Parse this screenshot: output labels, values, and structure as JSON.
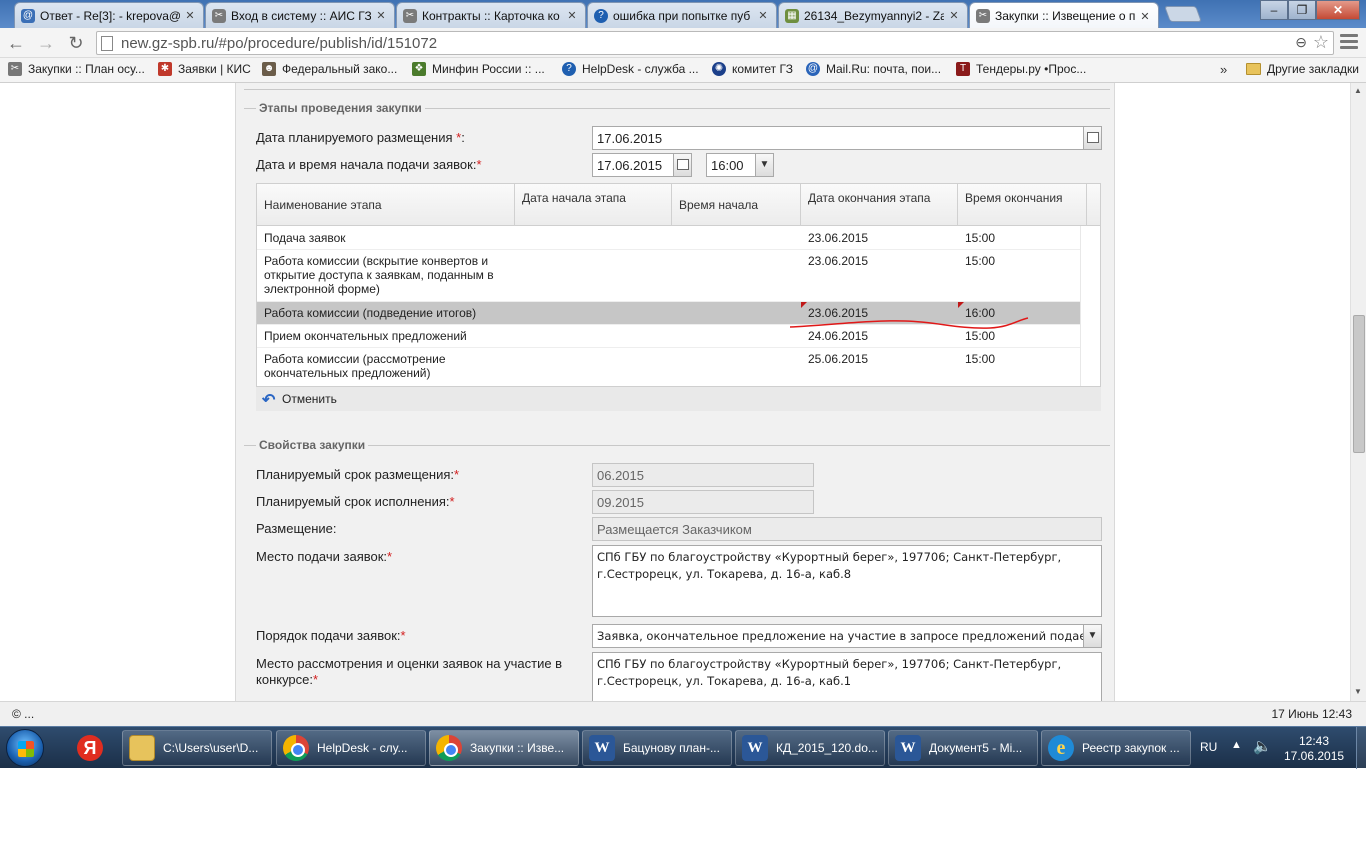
{
  "tabs": [
    {
      "title": "Ответ - Re[3]: - krepova@",
      "favicon_color": "#3b6fb6"
    },
    {
      "title": "Вход в систему :: АИС ГЗ",
      "favicon_color": "#7a7a7a"
    },
    {
      "title": "Контракты :: Карточка ко",
      "favicon_color": "#7a7a7a"
    },
    {
      "title": "ошибка при попытке пуб",
      "favicon_color": "#1f5fb0"
    },
    {
      "title": "26134_Bezymyannyi2 - Za",
      "favicon_color": "#6f8f3f"
    },
    {
      "title": "Закупки :: Извещение о п",
      "favicon_color": "#7a7a7a",
      "active": true
    }
  ],
  "browser": {
    "url": "new.gz-spb.ru/#po/procedure/publish/id/151072",
    "bookmarks": [
      {
        "label": "Закупки :: План осу...",
        "icon": "tools-icon",
        "color": "#777777"
      },
      {
        "label": "Заявки | КИС",
        "icon": "kis-icon",
        "color": "#c0392b"
      },
      {
        "label": "Федеральный зако...",
        "icon": "person-icon",
        "color": "#6b5d4a"
      },
      {
        "label": "Минфин России :: ...",
        "icon": "emblem-icon",
        "color": "#4b7b2c"
      },
      {
        "label": "HelpDesk - служба ...",
        "icon": "help-icon",
        "color": "#1f5fb0"
      },
      {
        "label": "комитет ГЗ",
        "icon": "globe-icon",
        "color": "#1b3f8a"
      },
      {
        "label": "Mail.Ru: почта, пои...",
        "icon": "mail-icon",
        "color": "#2a64b9"
      },
      {
        "label": "Тендеры.ру •Прос...",
        "icon": "t-icon",
        "color": "#8a1a1a"
      }
    ],
    "more": "»",
    "other_bookmarks": "Другие закладки"
  },
  "stages": {
    "legend": "Этапы проведения закупки",
    "planned_date_label": "Дата планируемого размещения ",
    "planned_date_value": "17.06.2015",
    "start_label": "Дата и время начала подачи заявок:",
    "start_date": "17.06.2015",
    "start_time": "16:00",
    "required_mark": "*",
    "colon": ":",
    "columns": [
      "Наименование этапа",
      "Дата начала этапа",
      "Время начала",
      "Дата окончания этапа",
      "Время окончания"
    ],
    "rows": [
      {
        "name": "Подача заявок",
        "end_date": "23.06.2015",
        "end_time": "15:00"
      },
      {
        "name": "Работа комиссии (вскрытие конвертов и открытие доступа к заявкам, поданным в электронной форме)",
        "end_date": "23.06.2015",
        "end_time": "15:00"
      },
      {
        "name": "Работа комиссии (подведение итогов)",
        "end_date": "23.06.2015",
        "end_time": "16:00",
        "selected": true
      },
      {
        "name": "Прием окончательных предложений",
        "end_date": "24.06.2015",
        "end_time": "15:00"
      },
      {
        "name": "Работа комиссии (рассмотрение окончательных предложений)",
        "end_date": "25.06.2015",
        "end_time": "15:00"
      }
    ],
    "undo_label": "Отменить"
  },
  "props": {
    "legend": "Свойства закупки",
    "plan_placement_label": "Планируемый срок размещения:",
    "plan_placement_value": "06.2015",
    "plan_execution_label": "Планируемый срок исполнения:",
    "plan_execution_value": "09.2015",
    "placement_label": "Размещение:",
    "placement_value": "Размещается Заказчиком",
    "submit_place_label": "Место подачи заявок:",
    "submit_place_value": "СПб ГБУ по благоустройству «Курортный берег», 197706; Санкт-Петербург, г.Сестрорецк, ул. Токарева, д. 16-а, каб.8",
    "order_label": "Порядок подачи заявок:",
    "order_value": "Заявка, окончательное предложение на участие в запросе предложений подает",
    "review_place_label_1": "Место рассмотрения и оценки заявок на участие в",
    "review_place_label_2": "конкурсе:",
    "review_place_value": "СПб ГБУ по благоустройству «Курортный берег», 197706; Санкт-Петербург, г.Сестрорецк, ул. Токарева, д. 16-а, каб.1"
  },
  "status": {
    "left": "© ...",
    "right": "17 Июнь 12:43"
  },
  "taskbar": {
    "items": [
      {
        "label": "",
        "icon": "yandex-icon"
      },
      {
        "label": "C:\\Users\\user\\D...",
        "icon": "folder-icon"
      },
      {
        "label": "HelpDesk - слу...",
        "icon": "chrome-icon"
      },
      {
        "label": "Закупки :: Изве...",
        "icon": "chrome-icon",
        "active": true
      },
      {
        "label": "Бацунову план-...",
        "icon": "word-icon"
      },
      {
        "label": "КД_2015_120.do...",
        "icon": "word-icon"
      },
      {
        "label": "Документ5 - Mi...",
        "icon": "word-icon"
      },
      {
        "label": "Реестр закупок ...",
        "icon": "ie-icon"
      }
    ],
    "lang": "RU",
    "time": "12:43",
    "date": "17.06.2015"
  }
}
